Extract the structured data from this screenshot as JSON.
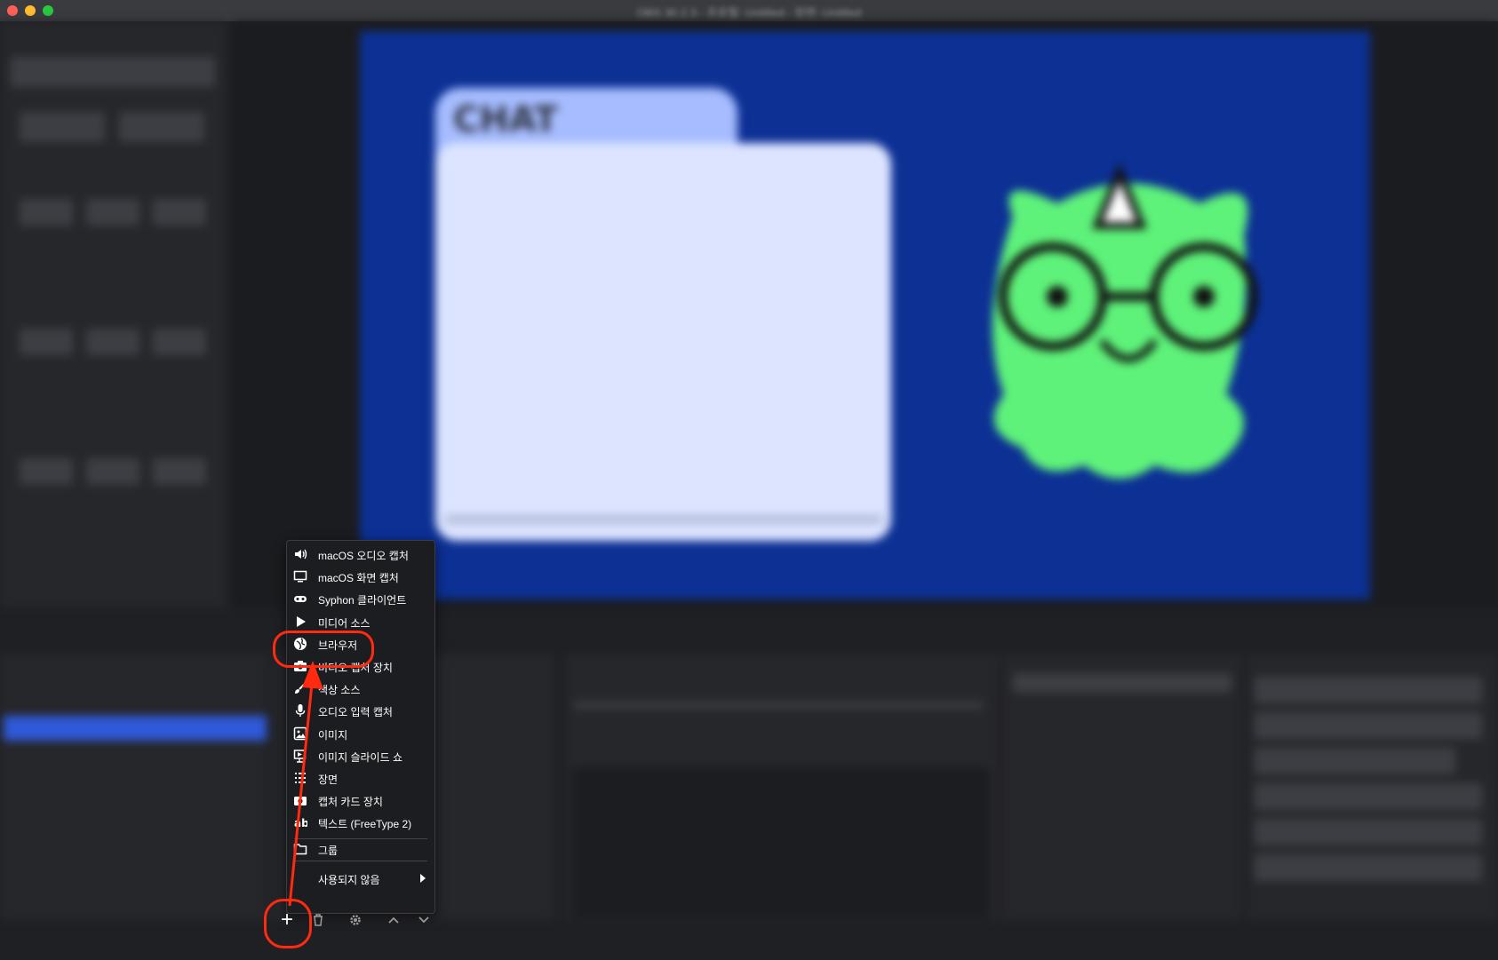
{
  "window": {
    "title": "OBS 30.2.3 - 프로필: Untitled - 장면: Untitled",
    "traffic_lights": [
      "#ff5f57",
      "#febc2e",
      "#28c840"
    ]
  },
  "preview": {
    "chat_title": "CHAT",
    "background_color": "#0c3094",
    "chat_tab_color": "#a6bcff",
    "chat_box_color": "#dce4ff",
    "mascot_color": "#5ef27a"
  },
  "add_source_menu": {
    "items": [
      {
        "label": "macOS 오디오 캡처",
        "icon": "speaker-icon"
      },
      {
        "label": "macOS 화면 캡처",
        "icon": "monitor-icon"
      },
      {
        "label": "Syphon 클라이언트",
        "icon": "gamepad-icon"
      },
      {
        "label": "미디어 소스",
        "icon": "play-icon"
      },
      {
        "label": "브라우저",
        "icon": "globe-icon"
      },
      {
        "label": "비디오 캡처 장치",
        "icon": "camera-icon"
      },
      {
        "label": "색상 소스",
        "icon": "brush-icon"
      },
      {
        "label": "오디오 입력 캡처",
        "icon": "microphone-icon"
      },
      {
        "label": "이미지",
        "icon": "image-icon"
      },
      {
        "label": "이미지 슬라이드 쇼",
        "icon": "slideshow-icon"
      },
      {
        "label": "장면",
        "icon": "list-icon"
      },
      {
        "label": "캡처 카드 장치",
        "icon": "capture-card-icon"
      },
      {
        "label": "텍스트 (FreeType 2)",
        "icon": "text-icon"
      },
      {
        "label": "그룹",
        "icon": "folder-icon"
      }
    ],
    "submenu_label": "사용되지 않음"
  },
  "sources_toolbar": {
    "add_icon": "plus-icon",
    "remove_icon": "trash-icon",
    "properties_icon": "gear-icon",
    "up_icon": "chevron-up-icon",
    "down_icon": "chevron-down-icon"
  },
  "annotation": {
    "color": "#ff2a10",
    "highlighted_item": "브라우저"
  }
}
